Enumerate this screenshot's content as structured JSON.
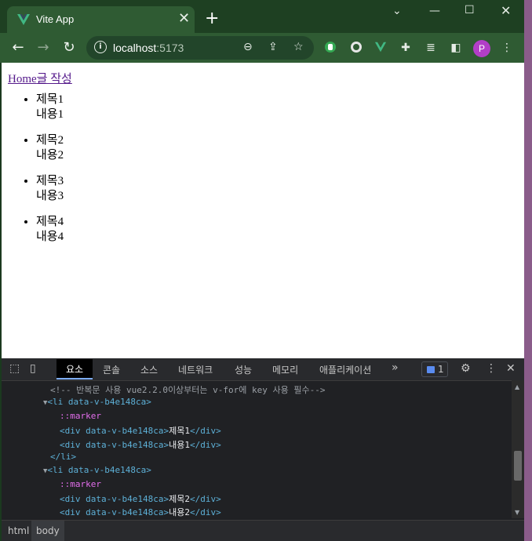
{
  "browser": {
    "tab_title": "Vite App",
    "url_host": "localhost",
    "url_port": ":5173",
    "profile_initial": "P"
  },
  "page": {
    "nav_home": "Home",
    "nav_write": "글 작성",
    "posts": [
      {
        "title": "제목1",
        "content": "내용1"
      },
      {
        "title": "제목2",
        "content": "내용2"
      },
      {
        "title": "제목3",
        "content": "내용3"
      },
      {
        "title": "제목4",
        "content": "내용4"
      }
    ]
  },
  "devtools": {
    "tabs": [
      "요소",
      "콘솔",
      "소스",
      "네트워크",
      "성능",
      "메모리",
      "애플리케이션"
    ],
    "more": "»",
    "issues_count": "1",
    "code": {
      "comment": "<!-- 반복문 사용 vue2.2.0이상부터는 v-for에 key 사용 필수-->",
      "li_open": "<li data-v-b4e148ca>",
      "marker": "::marker",
      "div_open": "<div data-v-b4e148ca>",
      "div_close": "</div>",
      "li_close": "</li>",
      "item1_title": "제목1",
      "item1_content": "내용1",
      "item2_title": "제목2",
      "item2_content": "내용2"
    },
    "breadcrumbs": [
      "html",
      "body"
    ]
  },
  "colors": {
    "frame": "#1e4022",
    "toolbar": "#2f5b33",
    "link": "#551a8b",
    "devtools_bg": "#202124",
    "accent": "#7cacf8"
  }
}
